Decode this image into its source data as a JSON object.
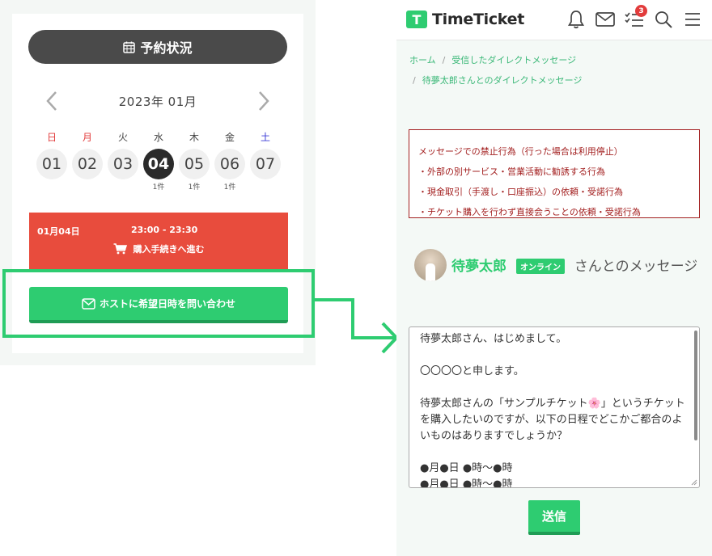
{
  "colors": {
    "accent_green": "#2ecc71",
    "slot_red": "#e84c3d",
    "warning_red": "#a32020",
    "header_dark": "#4a4a4a"
  },
  "reservation": {
    "header_title": "予約状況",
    "header_icon": "calendar-icon",
    "month_label": "2023年 01月",
    "days": [
      {
        "dow": "日",
        "date": "01",
        "count": ""
      },
      {
        "dow": "月",
        "date": "02",
        "count": ""
      },
      {
        "dow": "火",
        "date": "03",
        "count": ""
      },
      {
        "dow": "水",
        "date": "04",
        "count": "1件",
        "selected": true
      },
      {
        "dow": "木",
        "date": "05",
        "count": "1件"
      },
      {
        "dow": "金",
        "date": "06",
        "count": "1件"
      },
      {
        "dow": "土",
        "date": "07",
        "count": ""
      }
    ],
    "slot": {
      "date": "01月04日",
      "time": "23:00 - 23:30",
      "action": "購入手続きへ進む",
      "action_icon": "cart-icon"
    },
    "ask_button": "ホストに希望日時を問い合わせ",
    "ask_icon": "mail-icon"
  },
  "header": {
    "logo_mark": "T",
    "logo_text": "TimeTicket",
    "icons": [
      "bell-icon",
      "mail-icon",
      "checklist-icon",
      "search-icon",
      "menu-icon"
    ],
    "badge_count": "3"
  },
  "breadcrumb": {
    "home": "ホーム",
    "sep": "/",
    "received": "受信したダイレクトメッセージ",
    "current": "待夢太郎さんとのダイレクトメッセージ"
  },
  "warning": {
    "title": "メッセージでの禁止行為（行った場合は利用停止）",
    "items": [
      "・外部の別サービス・営業活動に勧誘する行為",
      "・現金取引（手渡し・口座振込）の依頼・受諾行為",
      "・チケット購入を行わず直接会うことの依頼・受諾行為"
    ]
  },
  "conversation": {
    "host_name": "待夢太郎",
    "online_label": "オンライン",
    "title_suffix": "さんとのメッセージ"
  },
  "message": {
    "text": "待夢太郎さん、はじめまして。\n\n〇〇〇〇と申します。\n\n待夢太郎さんの「サンプルチケット🌸」というチケットを購入したいのですが、以下の日程でどこかご都合のよいものはありますでしょうか？\n\n●月●日 ●時〜●時\n●月●日 ●時〜●時"
  },
  "send_label": "送信"
}
